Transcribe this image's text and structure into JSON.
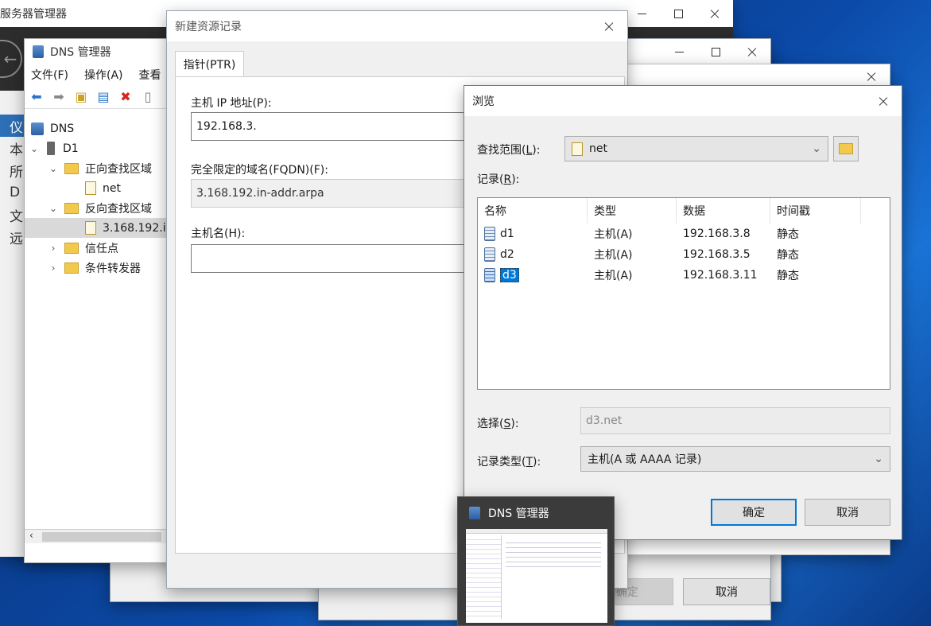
{
  "server_manager": {
    "title": "服务器管理器",
    "nav": [
      "仪",
      "本",
      "所",
      "D",
      "文",
      "远"
    ]
  },
  "dns_manager": {
    "title": "DNS 管理器",
    "menu": [
      "文件(F)",
      "操作(A)",
      "查看"
    ],
    "tree": {
      "root": "DNS",
      "server": "D1",
      "forward_zone": "正向查找区域",
      "forward_child": "net",
      "reverse_zone": "反向查找区域",
      "reverse_child": "3.168.192.i",
      "trust_points": "信任点",
      "conditional_forwarders": "条件转发器"
    }
  },
  "background_dialog": {
    "ok_label": "确定",
    "cancel_label": "取消"
  },
  "new_record": {
    "title": "新建资源记录",
    "tab": "指针(PTR)",
    "host_ip_label": "主机 IP 地址(P):",
    "host_ip_value": "192.168.3.",
    "fqdn_label": "完全限定的域名(FQDN)(F):",
    "fqdn_value": "3.168.192.in-addr.arpa",
    "hostname_label": "主机名(H):",
    "hostname_value": ""
  },
  "browse": {
    "title": "浏览",
    "scope_label_pre": "查找范围(",
    "scope_label_key": "L",
    "scope_label_post": "):",
    "scope_value": "net",
    "records_label_pre": "记录(",
    "records_label_key": "R",
    "records_label_post": "):",
    "columns": [
      "名称",
      "类型",
      "数据",
      "时间戳"
    ],
    "rows": [
      {
        "name": "d1",
        "type": "主机(A)",
        "data": "192.168.3.8",
        "timestamp": "静态"
      },
      {
        "name": "d2",
        "type": "主机(A)",
        "data": "192.168.3.5",
        "timestamp": "静态"
      },
      {
        "name": "d3",
        "type": "主机(A)",
        "data": "192.168.3.11",
        "timestamp": "静态"
      }
    ],
    "selection_label_pre": "选择(",
    "selection_label_key": "S",
    "selection_label_post": "):",
    "selection_value": "d3.net",
    "record_type_label_pre": "记录类型(",
    "record_type_label_key": "T",
    "record_type_label_post": "):",
    "record_type_value": "主机(A 或 AAAA 记录)",
    "ok_label": "确定",
    "cancel_label": "取消"
  },
  "taskbar_thumbnail": {
    "title": "DNS 管理器"
  }
}
